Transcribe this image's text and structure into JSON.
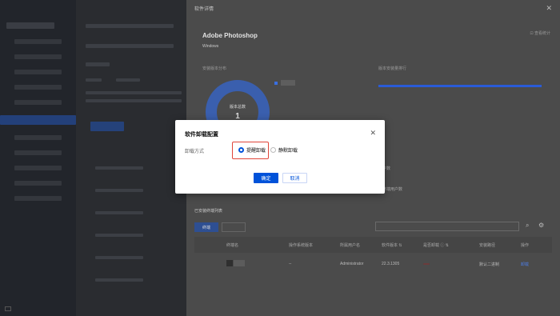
{
  "nav": {
    "foot_icon": "menu-icon"
  },
  "drawer": {
    "title": "软件详情",
    "close_glyph": "✕",
    "app_name": "Adobe Photoshop",
    "os_label": "Windows",
    "link_right": "⊡ 查看统计",
    "section_left": "安装版本分布",
    "section_right": "版本安装量排行",
    "donut_label": "版本总数",
    "donut_value": "1",
    "table_title": "已安装终端列表",
    "tab_primary": "终端",
    "search_placeholder": "",
    "columns": [
      "终端名",
      "操作系统版本",
      "所属用户名",
      "软件版本 ⇅",
      "是否卸载 ⓘ ⇅",
      "安装路径",
      "操作"
    ],
    "row": {
      "col2": "--",
      "user": "Administrator",
      "version": "22.3.1305",
      "badge": "",
      "path": "默认二进制",
      "action": "卸载"
    },
    "hint1": "户数",
    "hint2": "终端用户数"
  },
  "modal": {
    "title": "软件卸载配置",
    "close_glyph": "✕",
    "label": "卸载方式",
    "option1": "提醒卸载",
    "option2": "静默卸载",
    "selected": "option1",
    "ok": "确定",
    "cancel": "取消",
    "accent": "#0052d9",
    "highlight_color": "#e0453a"
  }
}
